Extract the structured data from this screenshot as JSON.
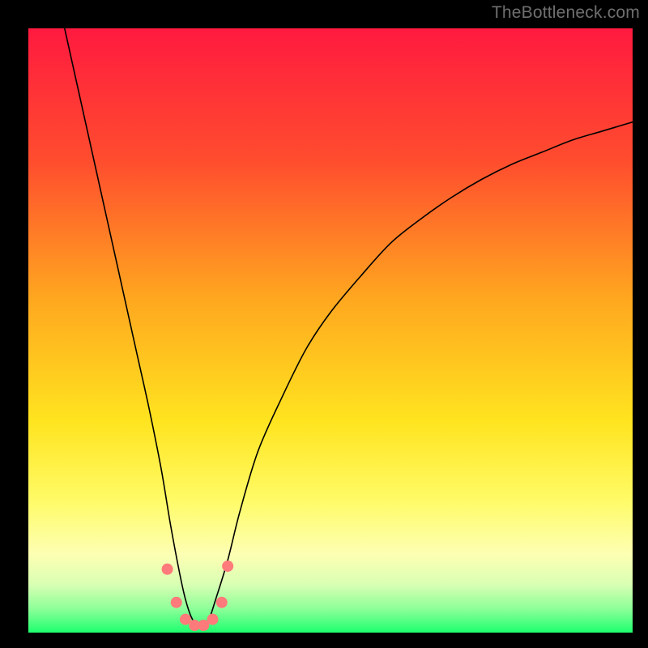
{
  "watermark": "TheBottleneck.com",
  "plot": {
    "margin": 35,
    "size": 746
  },
  "gradient_stops": [
    {
      "offset": 0.0,
      "color": "#ff1a3f"
    },
    {
      "offset": 0.22,
      "color": "#ff4d2e"
    },
    {
      "offset": 0.45,
      "color": "#ffa81f"
    },
    {
      "offset": 0.65,
      "color": "#ffe41f"
    },
    {
      "offset": 0.78,
      "color": "#fffb66"
    },
    {
      "offset": 0.87,
      "color": "#fdffb3"
    },
    {
      "offset": 0.92,
      "color": "#d9ffb3"
    },
    {
      "offset": 0.96,
      "color": "#8fff9a"
    },
    {
      "offset": 1.0,
      "color": "#1dff6e"
    }
  ],
  "chart_data": {
    "type": "line",
    "title": "",
    "xlabel": "",
    "ylabel": "",
    "xlim": [
      0,
      100
    ],
    "ylim": [
      0,
      100
    ],
    "series": [
      {
        "name": "curve",
        "color": "#000000",
        "stroke_width": 1.6,
        "x": [
          6,
          8,
          10,
          12,
          14,
          16,
          18,
          20,
          22,
          23.5,
          25,
          26,
          27,
          28,
          29,
          30,
          31,
          33,
          35,
          38,
          42,
          46,
          50,
          55,
          60,
          65,
          70,
          75,
          80,
          85,
          90,
          95,
          100
        ],
        "y": [
          100,
          91,
          82,
          73,
          64,
          55,
          46,
          37,
          27,
          18,
          10,
          5.5,
          2.5,
          1.2,
          1.2,
          2.5,
          5.5,
          12,
          20,
          30,
          39,
          47,
          53,
          59,
          64.5,
          68.5,
          72,
          75,
          77.5,
          79.5,
          81.5,
          83,
          84.5
        ]
      }
    ],
    "markers": {
      "name": "bottom-dots",
      "color": "#ff7a7a",
      "radius": 7,
      "x": [
        23.0,
        24.5,
        26.0,
        27.5,
        29.0,
        30.5,
        32.0,
        33.0
      ],
      "y": [
        10.5,
        5.0,
        2.2,
        1.2,
        1.2,
        2.2,
        5.0,
        11.0
      ]
    }
  }
}
